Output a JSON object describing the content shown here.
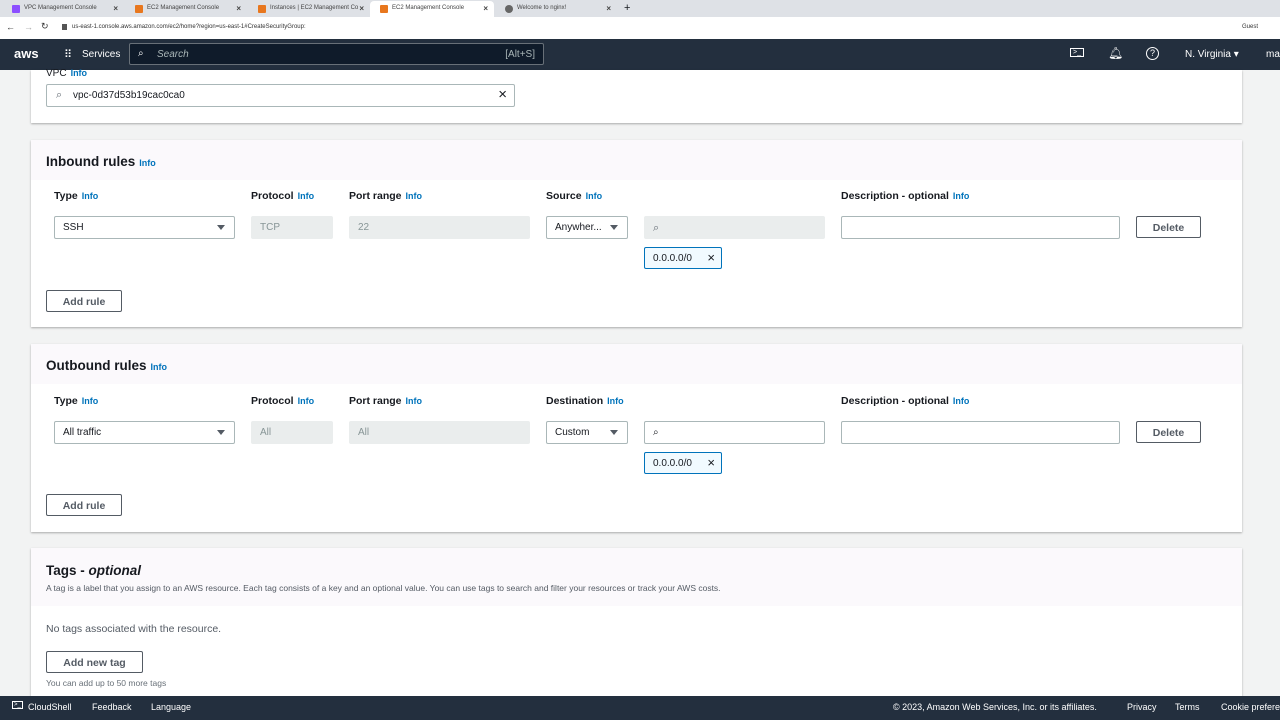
{
  "browser": {
    "tabs": [
      "VPC Management Console",
      "EC2 Management Console",
      "Instances | EC2 Management Co",
      "EC2 Management Console",
      "Welcome to nginx!"
    ],
    "url": "us-east-1.console.aws.amazon.com/ec2/home?region=us-east-1#CreateSecurityGroup:",
    "profile": "Guest"
  },
  "nav": {
    "logo": "aws",
    "services": "Services",
    "search_placeholder": "Search",
    "search_shortcut": "[Alt+S]",
    "region": "N. Virginia",
    "user": "ma"
  },
  "vpc": {
    "label": "VPC",
    "info": "Info",
    "value": "vpc-0d37d53b19cac0ca0"
  },
  "inbound": {
    "title": "Inbound rules",
    "info": "Info",
    "headers": {
      "type": "Type",
      "protocol": "Protocol",
      "port": "Port range",
      "source": "Source",
      "desc": "Description - optional"
    },
    "rule": {
      "type": "SSH",
      "protocol": "TCP",
      "port": "22",
      "source": "Anywher...",
      "cidr": "0.0.0.0/0",
      "delete": "Delete"
    },
    "add": "Add rule"
  },
  "outbound": {
    "title": "Outbound rules",
    "info": "Info",
    "headers": {
      "type": "Type",
      "protocol": "Protocol",
      "port": "Port range",
      "dest": "Destination",
      "desc": "Description - optional"
    },
    "rule": {
      "type": "All traffic",
      "protocol": "All",
      "port": "All",
      "dest": "Custom",
      "cidr": "0.0.0.0/0",
      "delete": "Delete"
    },
    "add": "Add rule"
  },
  "tags": {
    "title": "Tags - ",
    "title_opt": "optional",
    "desc": "A tag is a label that you assign to an AWS resource. Each tag consists of a key and an optional value. You can use tags to search and filter your resources or track your AWS costs.",
    "empty": "No tags associated with the resource.",
    "add": "Add new tag",
    "limit": "You can add up to 50 more tags"
  },
  "footer": {
    "cloudshell": "CloudShell",
    "feedback": "Feedback",
    "language": "Language",
    "copyright": "© 2023, Amazon Web Services, Inc. or its affiliates.",
    "privacy": "Privacy",
    "terms": "Terms",
    "cookie": "Cookie prefere"
  }
}
